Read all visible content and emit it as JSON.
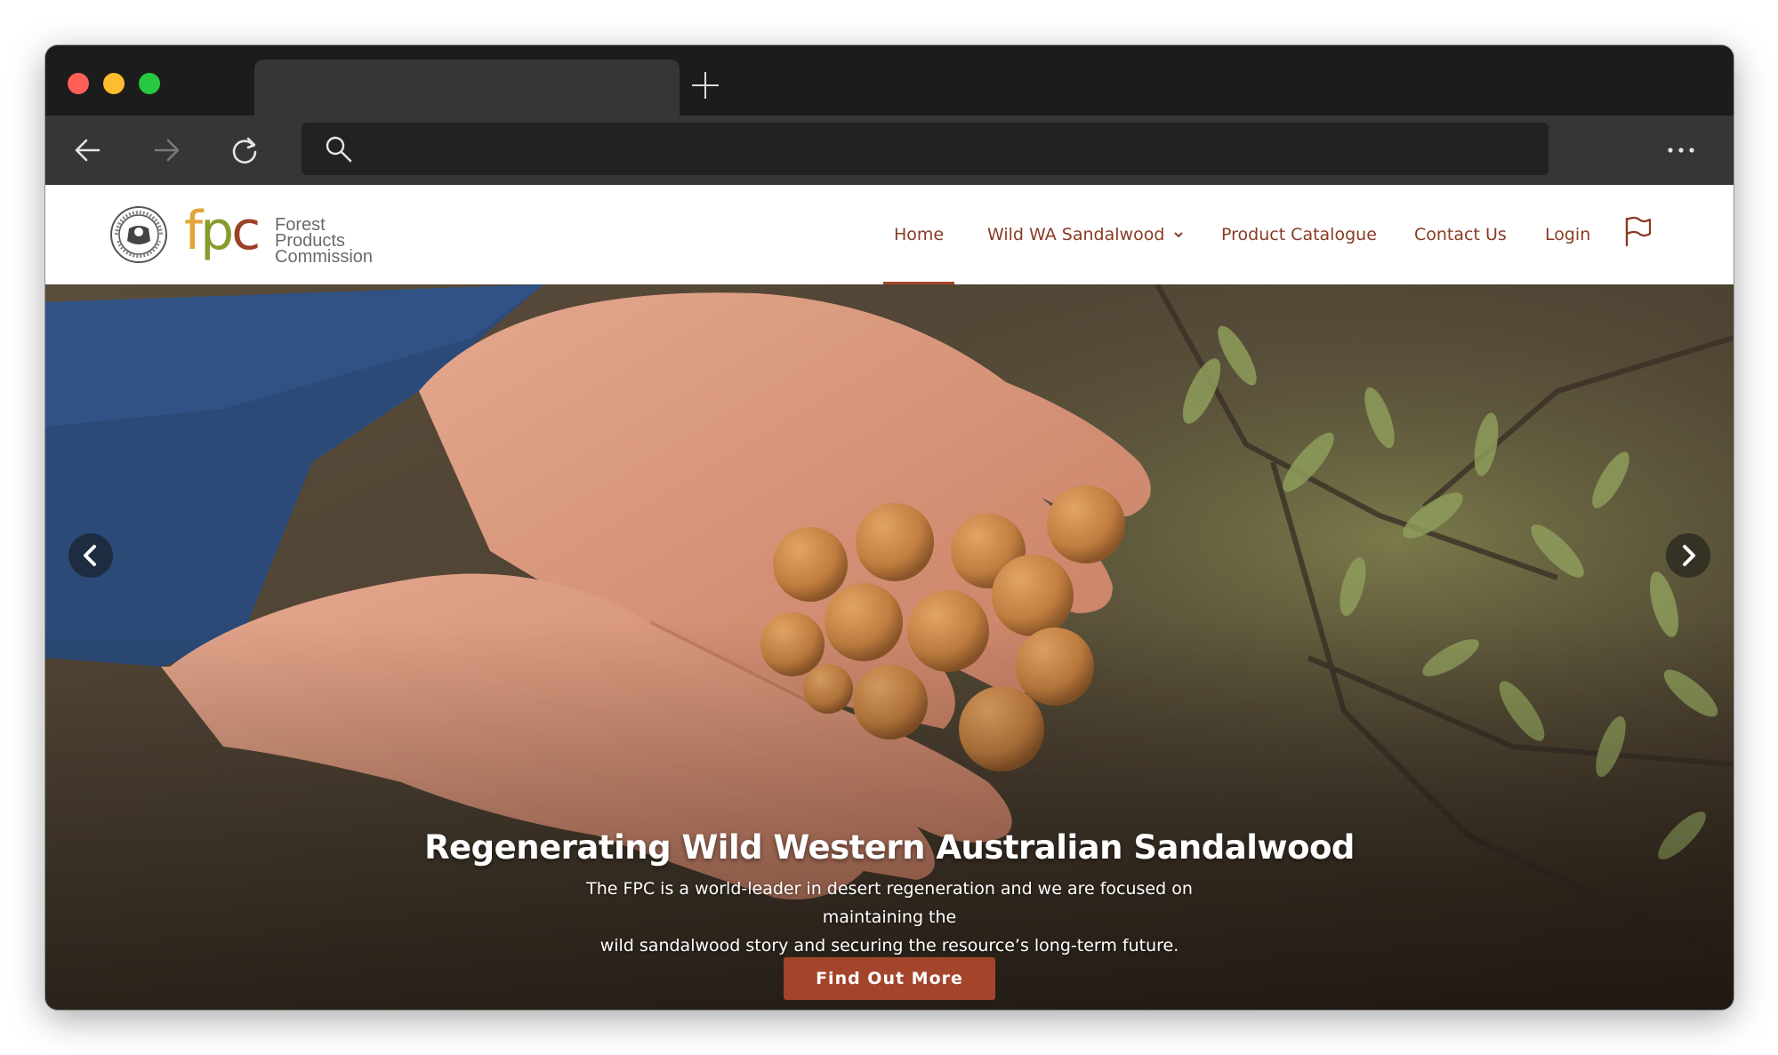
{
  "browser": {
    "tab_title": "",
    "address_placeholder": "",
    "icons": [
      "back-arrow-icon",
      "forward-arrow-icon",
      "reload-icon",
      "search-icon",
      "more-icon",
      "new-tab-icon"
    ]
  },
  "site": {
    "logo": {
      "letters": "fpc",
      "name_line1": "Forest Products",
      "name_line2": "Commission"
    },
    "nav": {
      "home": "Home",
      "sandalwood": "Wild WA Sandalwood",
      "catalogue": "Product Catalogue",
      "contact": "Contact Us",
      "login": "Login"
    },
    "colors": {
      "accent": "#a3452b",
      "nav_text": "#8a3a24"
    }
  },
  "hero": {
    "title": "Regenerating Wild Western Australian Sandalwood",
    "subtitle_line1": "The FPC is a world-leader in desert regeneration and we are focused on maintaining the",
    "subtitle_line2": "wild sandalwood story and securing the resource’s long-term future.",
    "button": "Find Out More"
  }
}
